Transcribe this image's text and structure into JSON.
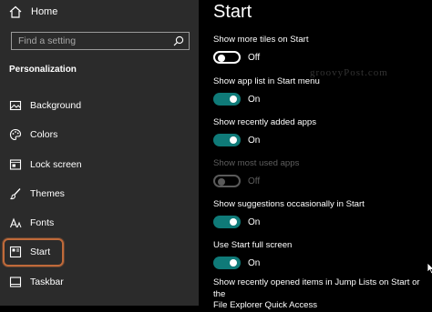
{
  "sidebar": {
    "home_label": "Home",
    "search_placeholder": "Find a setting",
    "section_title": "Personalization",
    "items": [
      {
        "label": "Background",
        "icon": "image-icon"
      },
      {
        "label": "Colors",
        "icon": "palette-icon"
      },
      {
        "label": "Lock screen",
        "icon": "lock-screen-icon"
      },
      {
        "label": "Themes",
        "icon": "brush-icon"
      },
      {
        "label": "Fonts",
        "icon": "fonts-icon"
      },
      {
        "label": "Start",
        "icon": "start-icon",
        "active": true
      },
      {
        "label": "Taskbar",
        "icon": "taskbar-icon"
      }
    ]
  },
  "main": {
    "title": "Start",
    "watermark": "groovyPost.com",
    "settings": [
      {
        "name": "Show more tiles on Start",
        "state": "Off",
        "on": false,
        "disabled": false
      },
      {
        "name": "Show app list in Start menu",
        "state": "On",
        "on": true,
        "disabled": false
      },
      {
        "name": "Show recently added apps",
        "state": "On",
        "on": true,
        "disabled": false
      },
      {
        "name": "Show most used apps",
        "state": "Off",
        "on": false,
        "disabled": true
      },
      {
        "name": "Show suggestions occasionally in Start",
        "state": "On",
        "on": true,
        "disabled": false
      },
      {
        "name": "Use Start full screen",
        "state": "On",
        "on": true,
        "disabled": false
      }
    ],
    "bottom_setting_line1": "Show recently opened items in Jump Lists on Start or the",
    "bottom_setting_line2": "File Explorer Quick Access"
  },
  "colors": {
    "accent": "#0f7a78",
    "sidebar_bg": "#2b2b2b",
    "highlight_border": "#c06a3a"
  }
}
